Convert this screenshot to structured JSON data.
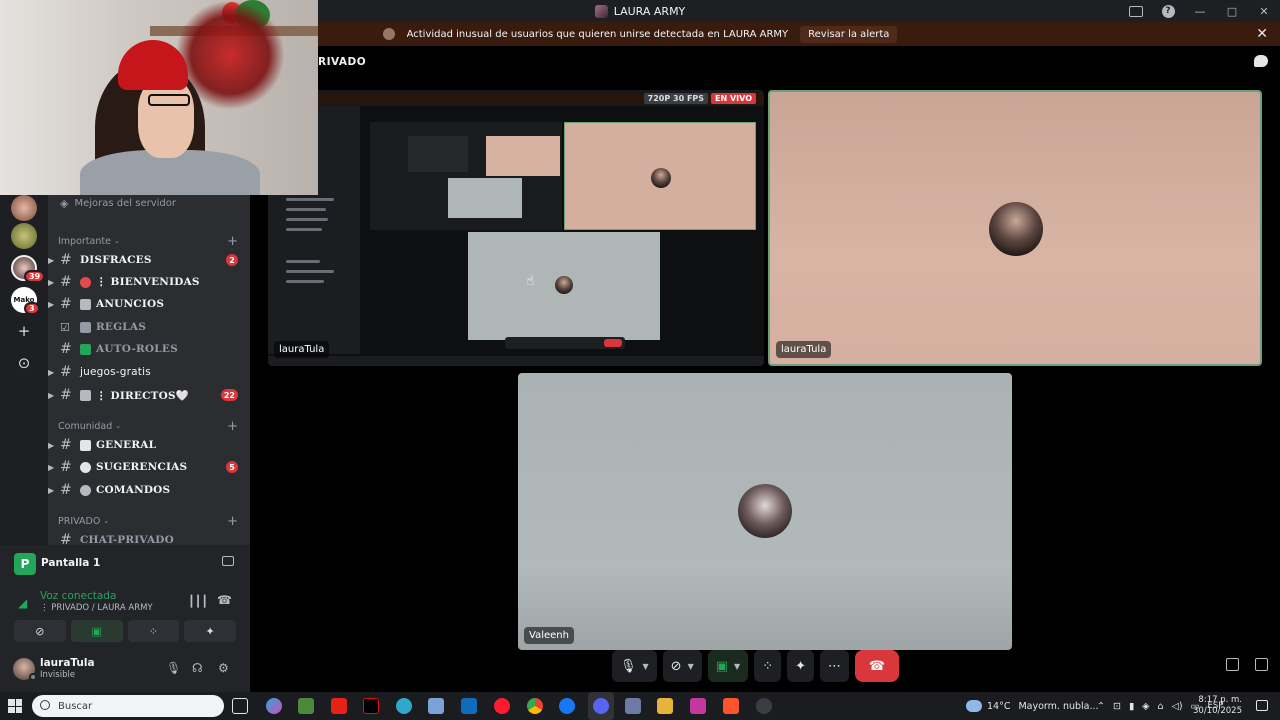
{
  "window": {
    "title": "LAURA ARMY",
    "buttons": {
      "minimize": "—",
      "maximize": "□",
      "close": "✕"
    }
  },
  "alert": {
    "message": "Actividad inusual de usuarios que quieren unirse detectada en LAURA ARMY",
    "action_label": "Revisar la alerta",
    "close": "✕"
  },
  "rail": {
    "badges": [
      "39",
      "3"
    ],
    "mako_label": "Mako"
  },
  "channels": {
    "server_boost": "Mejoras del servidor",
    "categories": [
      {
        "name": "Importante"
      },
      {
        "name": "Comunidad"
      },
      {
        "name": "PRIVADO"
      }
    ],
    "items": [
      {
        "name": "DISFRACES",
        "badge": "2"
      },
      {
        "name": "⋮ BIENVENIDAS",
        "badge": ""
      },
      {
        "name": "ANUNCIOS",
        "badge": ""
      },
      {
        "name": "REGLAS",
        "badge": ""
      },
      {
        "name": "AUTO-ROLES",
        "badge": ""
      },
      {
        "name": "juegos-gratis",
        "badge": ""
      },
      {
        "name": "⋮ DIRECTOS🤍",
        "badge": "22"
      },
      {
        "name": "GENERAL",
        "badge": ""
      },
      {
        "name": "SUGERENCIAS",
        "badge": "5"
      },
      {
        "name": "COMANDOS",
        "badge": ""
      },
      {
        "name": "CHAT-PRIVADO",
        "badge": ""
      }
    ]
  },
  "voice_panel": {
    "screen_title": "Pantalla 1",
    "status": "Voz conectada",
    "channel": "⋮ PRIVADO / LAURA ARMY"
  },
  "user": {
    "name": "lauraTula",
    "status": "Invisible"
  },
  "stage": {
    "title": "RIVADO",
    "stream_quality": "720P 30 FPS",
    "live_label": "EN VIVO",
    "tiles": [
      {
        "label": "lauraTula"
      },
      {
        "label": "lauraTula"
      },
      {
        "label": "Valeenh"
      }
    ]
  },
  "taskbar": {
    "search_placeholder": "Buscar",
    "weather": "14°C",
    "weather_desc": "Mayorm. nubla...",
    "lang": "ESP",
    "time": "8:17 p. m.",
    "date": "30/10/2025"
  },
  "colors": {
    "accent_green": "#23a55a",
    "danger_red": "#da373c",
    "tile_peach": "#d4ae9e",
    "tile_gray": "#aeb6b6"
  }
}
